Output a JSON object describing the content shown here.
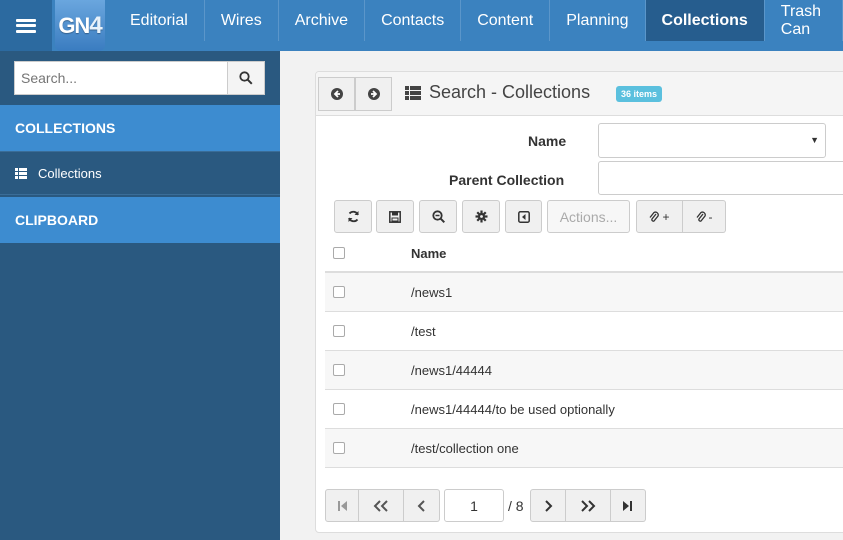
{
  "logo": {
    "text": "GN",
    "number": "4"
  },
  "nav": {
    "items": [
      {
        "label": "Editorial"
      },
      {
        "label": "Wires"
      },
      {
        "label": "Archive"
      },
      {
        "label": "Contacts"
      },
      {
        "label": "Content"
      },
      {
        "label": "Planning"
      },
      {
        "label": "Collections",
        "active": true
      },
      {
        "label": "Trash Can"
      }
    ]
  },
  "sidebar": {
    "search_placeholder": "Search...",
    "sections": [
      {
        "label": "COLLECTIONS"
      },
      {
        "label": "CLIPBOARD"
      }
    ],
    "items": [
      {
        "label": "Collections"
      }
    ]
  },
  "panel": {
    "title": "Search - Collections",
    "badge": "36 items",
    "form": {
      "name_label": "Name",
      "name_value": "",
      "parent_label": "Parent Collection",
      "parent_value": ""
    },
    "toolbar": {
      "actions_label": "Actions...",
      "attach_add_label": "+",
      "attach_remove_label": "-"
    },
    "grid": {
      "column_name": "Name",
      "rows": [
        {
          "name": "/news1"
        },
        {
          "name": "/test"
        },
        {
          "name": "/news1/44444"
        },
        {
          "name": "/news1/44444/to be used optionally"
        },
        {
          "name": "/test/collection one"
        }
      ]
    },
    "pager": {
      "current_page": "1",
      "total_pages": "/ 8"
    }
  },
  "colors": {
    "topbar": "#3b82bf",
    "sidebar": "#2a5980",
    "sidebar_section": "#3d8cd0",
    "active_nav": "#265d8e",
    "badge": "#5bc0de"
  }
}
